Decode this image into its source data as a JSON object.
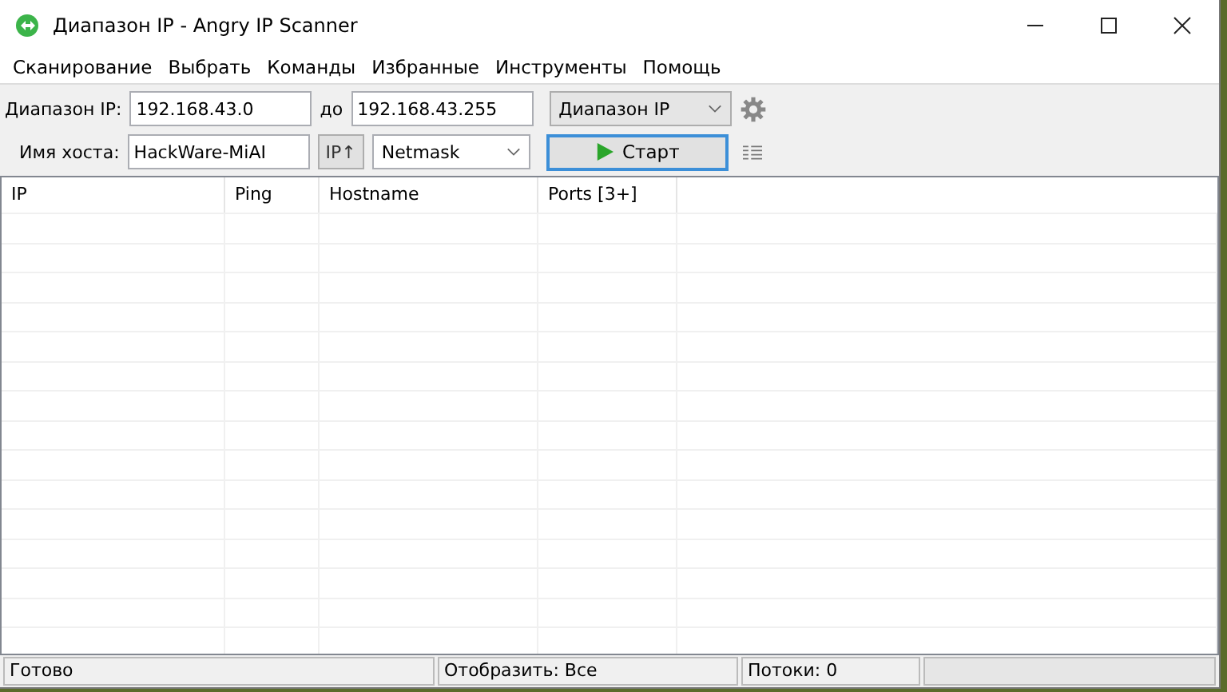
{
  "window": {
    "title": "Диапазон IP - Angry IP Scanner"
  },
  "menu": [
    "Сканирование",
    "Выбрать",
    "Команды",
    "Избранные",
    "Инструменты",
    "Помощь"
  ],
  "toolbar": {
    "range_label": "Диапазон IP:",
    "range_from": "192.168.43.0",
    "to_label": "до",
    "range_to": "192.168.43.255",
    "feeder": "Диапазон IP",
    "host_label": "Имя хоста:",
    "hostname": "HackWare-MiAI",
    "ip_button": "IP↑",
    "netmask": "Netmask",
    "start_button": "Старт"
  },
  "table": {
    "columns": [
      "IP",
      "Ping",
      "Hostname",
      "Ports [3+]"
    ]
  },
  "status_bar": [
    "Готово",
    "Отобразить: Все",
    "Потоки: 0"
  ]
}
